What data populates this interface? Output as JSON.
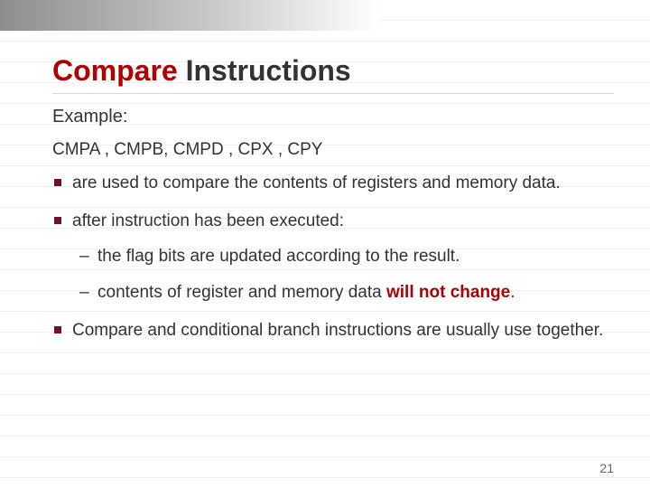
{
  "title": {
    "accent": "Compare",
    "rest": "Instructions"
  },
  "example_label": "Example:",
  "mnemonics": "CMPA , CMPB, CMPD , CPX , CPY",
  "bullets": {
    "b1": "are used to compare the contents of registers and memory data.",
    "b2": "after instruction has been executed:",
    "b2_sub1": "the flag bits are updated according to the result.",
    "b2_sub2_pre": "contents of register and memory data ",
    "b2_sub2_strong": "will not change",
    "b2_sub2_post": ".",
    "b3": "Compare and conditional branch instructions are usually use together."
  },
  "slide_number": "21"
}
